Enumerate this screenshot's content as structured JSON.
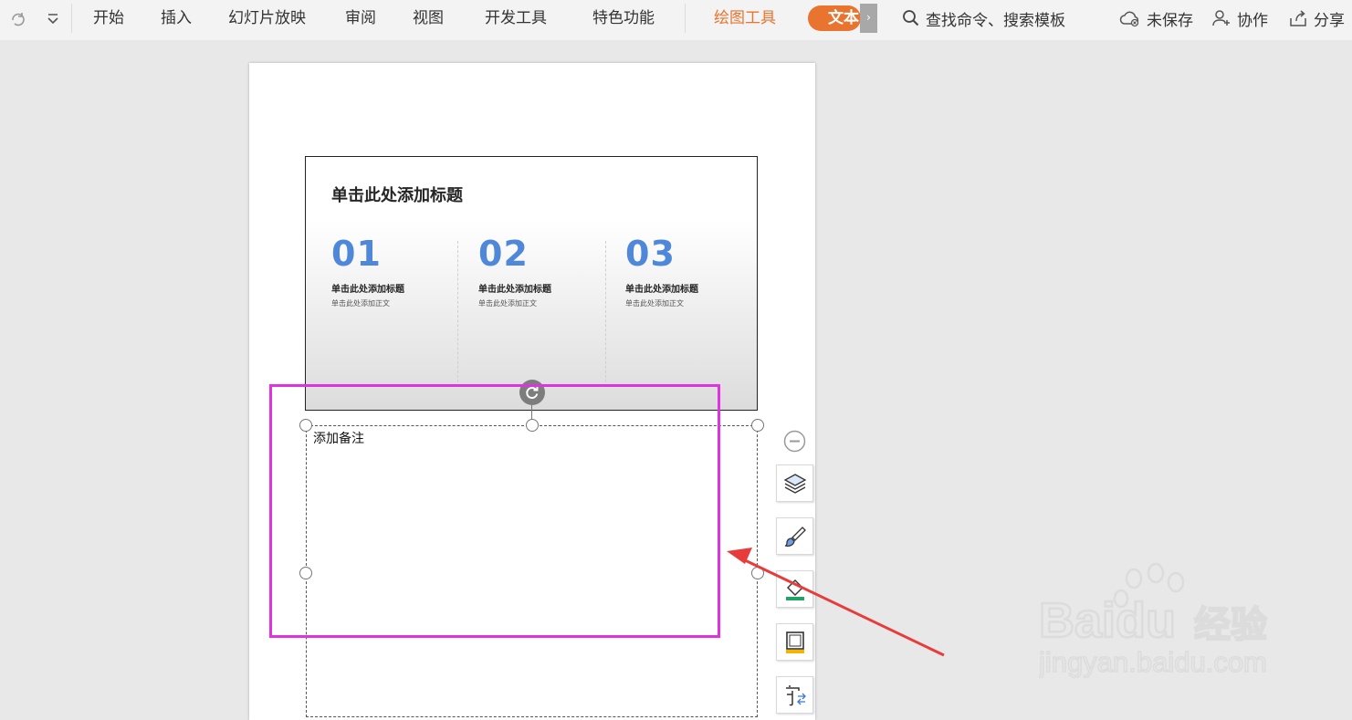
{
  "toolbar": {
    "menu": [
      "开始",
      "插入",
      "幻灯片放映",
      "审阅",
      "视图",
      "开发工具",
      "特色功能"
    ],
    "drawing_tools": "绘图工具",
    "text_tab": "文本",
    "search": "查找命令、搜索模板",
    "unsaved": "未保存",
    "collaborate": "协作",
    "share": "分享",
    "accent_color": "#e8742f"
  },
  "slide": {
    "title": "单击此处添加标题",
    "columns": [
      {
        "num": "01",
        "subtitle": "单击此处添加标题",
        "body": "单击此处添加正文"
      },
      {
        "num": "02",
        "subtitle": "单击此处添加标题",
        "body": "单击此处添加正文"
      },
      {
        "num": "03",
        "subtitle": "单击此处添加标题",
        "body": "单击此处添加正文"
      }
    ],
    "number_color": "#4f88d8"
  },
  "notes": {
    "placeholder": "添加备注"
  },
  "annotation": {
    "highlight_color": "#e033e0",
    "arrow_color": "#e83c3c"
  },
  "watermark": {
    "brand": "Baidu",
    "brand_cn": "经验",
    "url": "jingyan.baidu.com"
  },
  "icons": [
    "redo-icon",
    "dropdown-icon",
    "search-icon",
    "cloud-icon",
    "collaborate-icon",
    "share-icon",
    "rotate-icon",
    "zoom-out-icon",
    "layers-icon",
    "brush-icon",
    "fill-icon",
    "border-icon",
    "text-icon"
  ]
}
